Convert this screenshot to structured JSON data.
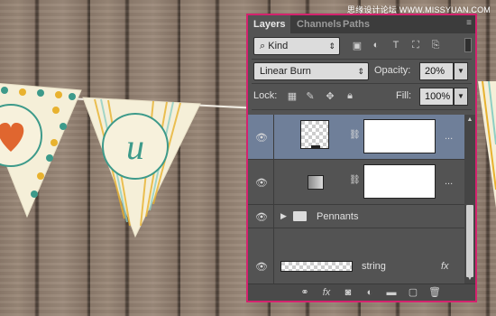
{
  "watermark": "思缘设计论坛 WWW.MISSYUAN.COM",
  "panel": {
    "tabs": [
      "Layers",
      "Channels",
      "Paths"
    ],
    "filter_kind": "Kind",
    "blend_mode": "Linear Burn",
    "opacity_label": "Opacity:",
    "opacity_value": "20%",
    "lock_label": "Lock:",
    "fill_label": "Fill:",
    "fill_value": "100%",
    "layers": [
      {
        "name": "",
        "type": "gradient-fill-selected"
      },
      {
        "name": "",
        "type": "gradient-fill"
      },
      {
        "name": "Pennants",
        "type": "group"
      },
      {
        "name": "string",
        "type": "pixel",
        "fx": "fx"
      }
    ]
  },
  "pennants": {
    "letter": "u"
  },
  "colors": {
    "panel_border": "#d4236e",
    "panel_bg": "#535353",
    "selected_row": "#6f7f99",
    "heart": "#e0662f",
    "pennant_teal": "#3d9a8a"
  }
}
